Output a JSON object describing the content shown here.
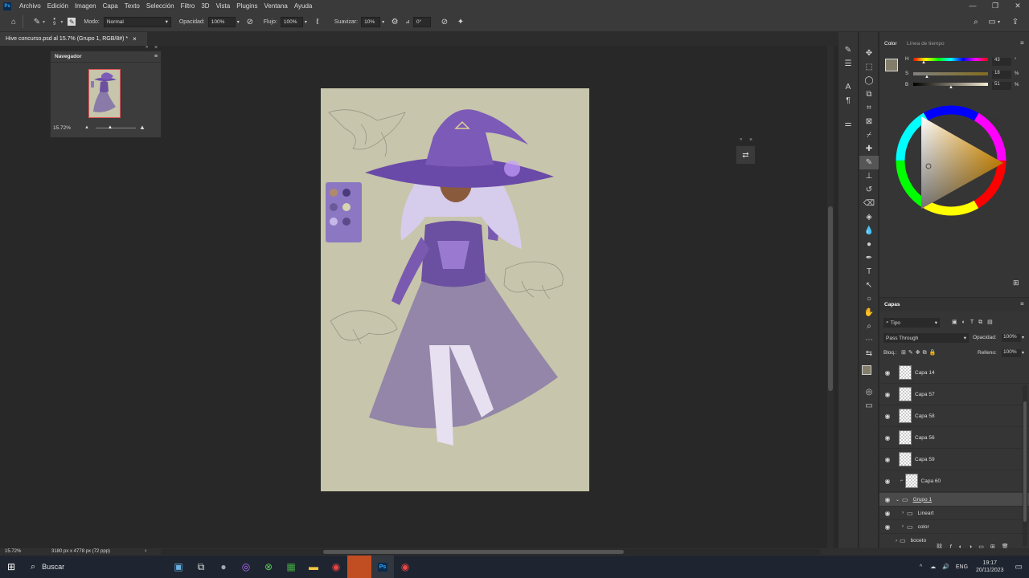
{
  "menubar": {
    "logo": "Ps",
    "items": [
      "Archivo",
      "Edición",
      "Imagen",
      "Capa",
      "Texto",
      "Selección",
      "Filtro",
      "3D",
      "Vista",
      "Plugins",
      "Ventana",
      "Ayuda"
    ],
    "controls": [
      "—",
      "❐",
      "✕"
    ]
  },
  "options": {
    "brush_size": "9",
    "mode_label": "Modo:",
    "mode_value": "Normal",
    "opacity_label": "Opacidad:",
    "opacity_value": "100%",
    "flow_label": "Flujo:",
    "flow_value": "100%",
    "smooth_label": "Suavizar:",
    "smooth_value": "10%",
    "angle_label": "⊿",
    "angle_value": "0°"
  },
  "document": {
    "tab_title": "Hive concurso.psd al 15.7% (Grupo 1, RGB/8#) *",
    "close": "×"
  },
  "navigator": {
    "title": "Navegador",
    "zoom": "15.72%"
  },
  "color_panel": {
    "tabs": [
      "Color",
      "Línea de tiempo"
    ],
    "h_label": "H",
    "h_value": "43",
    "s_label": "S",
    "s_value": "18",
    "b_label": "B",
    "b_value": "51",
    "pct": "%"
  },
  "layers_panel": {
    "title": "Capas",
    "filter_kind": "Tipo",
    "blend_mode": "Pass Through",
    "opacity_label": "Opacidad:",
    "opacity_value": "100%",
    "lock_label": "Bloq.:",
    "fill_label": "Relleno:",
    "fill_value": "100%",
    "layers": [
      "Capa 14",
      "Capa 57",
      "Capa 58",
      "Capa 56",
      "Capa 59",
      "Capa 60"
    ],
    "groups": [
      "Grupo 1",
      "Lineart",
      "color",
      "boceto"
    ]
  },
  "status": {
    "zoom": "15.72%",
    "doc_info": "3180 px x 4778 px (72 ppp)"
  },
  "taskbar": {
    "search": "Buscar",
    "tray": [
      "^",
      "☁",
      "🔊",
      "ENG"
    ],
    "time": "19:17",
    "date": "20/11/2023"
  },
  "colors": {
    "canvas_bg": "#c7c5ab",
    "panel_bg": "#353535",
    "fg_swatch": "#837e6b",
    "ps_blue": "#31a8ff"
  }
}
